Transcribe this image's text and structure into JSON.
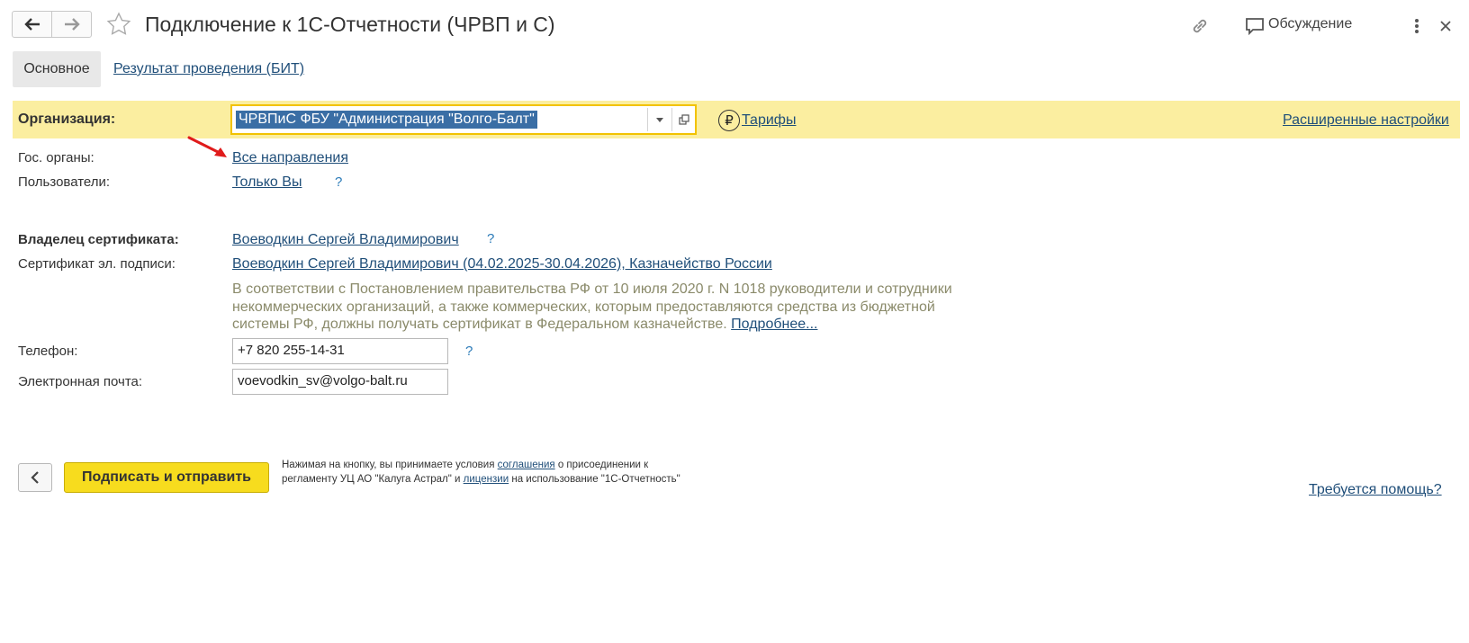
{
  "header": {
    "title": "Подключение к 1С-Отчетности (ЧРВП и С)",
    "discussion_label": "Обсуждение"
  },
  "tabs": {
    "main": "Основное",
    "result": "Результат проведения (БИТ)"
  },
  "organization": {
    "label": "Организация:",
    "value": "ЧРВПиС ФБУ \"Администрация \"Волго-Балт\"",
    "tariffs_label": "Тарифы",
    "extended_settings_label": "Расширенные настройки"
  },
  "gov_bodies": {
    "label": "Гос. органы:",
    "value": "Все направления"
  },
  "users": {
    "label": "Пользователи:",
    "value": "Только Вы",
    "help": "?"
  },
  "cert_owner": {
    "label": "Владелец сертификата:",
    "value": "Воеводкин Сергей Владимирович",
    "help": "?"
  },
  "certificate": {
    "label": "Сертификат эл. подписи:",
    "value": "Воеводкин Сергей Владимирович (04.02.2025-30.04.2026), Казначейство России",
    "note_line1": "В соответствии с Постановлением правительства РФ от 10 июля 2020 г. N 1018 руководители и сотрудники",
    "note_line2": "некоммерческих организаций, а также коммерческих, которым предоставляются средства из бюджетной",
    "note_line3": "системы РФ, должны получать сертификат в Федеральном казначействе.",
    "note_more": "Подробнее..."
  },
  "phone": {
    "label": "Телефон:",
    "value": "+7 820 255-14-31",
    "help": "?"
  },
  "email": {
    "label": "Электронная почта:",
    "value": "voevodkin_sv@volgo-balt.ru"
  },
  "footer": {
    "sign_button": "Подписать и отправить",
    "agree_part1": "Нажимая на кнопку, вы принимаете условия",
    "agree_link1": "соглашения",
    "agree_part2": "о присоединении к регламенту УЦ АО \"Калуга Астрал\" и",
    "agree_link2": "лицензии",
    "agree_part3": "на использование \"1С-Отчетность\"",
    "help_link": "Требуется помощь?"
  },
  "colors": {
    "org_band": "#fbeea0",
    "accent_button": "#f7dc1e",
    "link": "#1f4e79",
    "annotation_arrow": "#e01b1b"
  },
  "icons": [
    "arrow-left-icon",
    "arrow-right-icon",
    "star-icon",
    "link-icon",
    "discussion-icon",
    "more-vertical-icon",
    "close-icon",
    "dropdown-icon",
    "open-icon",
    "ruble-icon",
    "chevron-left-icon",
    "red-arrow-annotation"
  ]
}
